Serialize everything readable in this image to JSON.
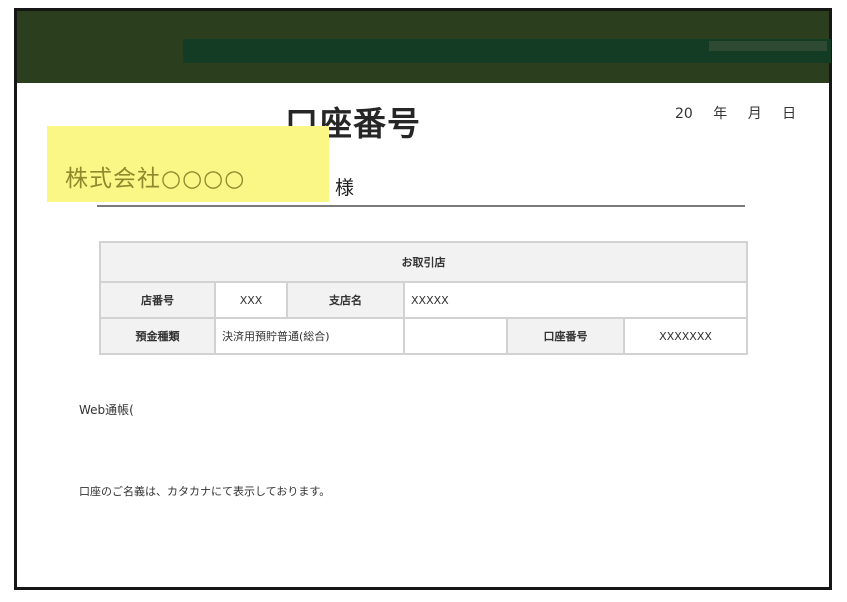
{
  "document": {
    "title": "口座番号",
    "date": "20 年 月 日",
    "company": "株式会社○○○○",
    "honorific": "様",
    "table": {
      "header": "お取引店",
      "row1": {
        "label1": "店番号",
        "value1": "XXX",
        "label2": "支店名",
        "value2": "XXXXX"
      },
      "row2": {
        "label1": "預金種類",
        "value1": "決済用預貯普通(総合)",
        "label2": "口座番号",
        "value2": "XXXXXXX"
      }
    },
    "web_label": "Web通帳(",
    "note": "口座のご名義は、カタカナにて表示しております。"
  },
  "colors": {
    "header_bar": "#2b3e1d",
    "header_band": "#143c24",
    "highlight": "#fbf787",
    "table_header_bg": "#f2f2f2"
  }
}
